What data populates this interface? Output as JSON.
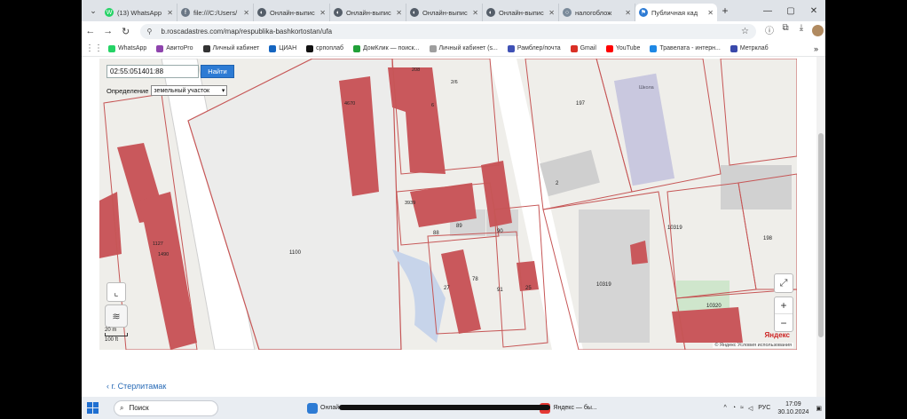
{
  "browser": {
    "tabs": [
      {
        "title": "(13) WhatsApp",
        "color": "#25d366",
        "glyph": "W"
      },
      {
        "title": "file:///C:/Users/",
        "color": "#6b7785",
        "glyph": "f"
      },
      {
        "title": "Онлайн-выпис",
        "color": "#555e69",
        "glyph": "◐"
      },
      {
        "title": "Онлайн-выпис",
        "color": "#555e69",
        "glyph": "◐"
      },
      {
        "title": "Онлайн-выпис",
        "color": "#555e69",
        "glyph": "◐"
      },
      {
        "title": "Онлайн-выпис",
        "color": "#555e69",
        "glyph": "◐"
      },
      {
        "title": "налогоблож",
        "color": "#7a8a9a",
        "glyph": "○"
      },
      {
        "title": "Публичная кад",
        "color": "#2d7bd4",
        "glyph": "⚑",
        "active": true
      }
    ],
    "new_tab": "+",
    "url": "b.roscadastres.com/map/respublika-bashkortostan/ufa",
    "bookmarks": [
      {
        "label": "WhatsApp",
        "color": "#25d366"
      },
      {
        "label": "АвитоPro",
        "color": "#8e44ad"
      },
      {
        "label": "Личный кабинет",
        "color": "#333333"
      },
      {
        "label": "ЦИАН",
        "color": "#1565c0"
      },
      {
        "label": "српоплаб",
        "color": "#111111"
      },
      {
        "label": "ДомКлик — поиск...",
        "color": "#21a038"
      },
      {
        "label": "Личный кабинет (s...",
        "color": "#9e9e9e"
      },
      {
        "label": "Рамблер/почта",
        "color": "#3f51b5"
      },
      {
        "label": "Gmail",
        "color": "#d93025"
      },
      {
        "label": "YouTube",
        "color": "#ff0000"
      },
      {
        "label": "Травелата - интерн...",
        "color": "#1e88e5"
      },
      {
        "label": "Метрклаб",
        "color": "#3949ab"
      }
    ],
    "bookmarks_more": "»"
  },
  "map": {
    "cadastral_input": "02:55:051401:88",
    "find_button": "Найти",
    "define_label": "Определение",
    "define_value": "земельный участок",
    "scale_top": "20 m",
    "scale_bottom": "100 ft",
    "zoom_in": "+",
    "zoom_out": "−",
    "provider": "Яндекс",
    "terms": "© Яндекс Условия использования",
    "parcel_labels": {
      "p1100": "1100",
      "p197": "197",
      "p10319": "10319",
      "p10319b": "10319",
      "p198": "198",
      "p88": "88",
      "p89": "89",
      "p90": "90",
      "p91": "91",
      "p78": "78",
      "p25": "25",
      "p27": "27",
      "p2": "2",
      "p3939": "3939",
      "p10320": "10320",
      "p4670": "4670",
      "p1127": "1127",
      "p1490": "1490",
      "p2b": "2/6",
      "school": "Школа",
      "p208": "208",
      "p6": "6"
    }
  },
  "page": {
    "back_link": "г. Стерлитамак"
  },
  "taskbar": {
    "search_placeholder": "Поиск",
    "app1": "Онлайн-",
    "app2": "Яндекс — бы...",
    "lang": "РУС",
    "time": "17:09",
    "date": "30.10.2024"
  }
}
